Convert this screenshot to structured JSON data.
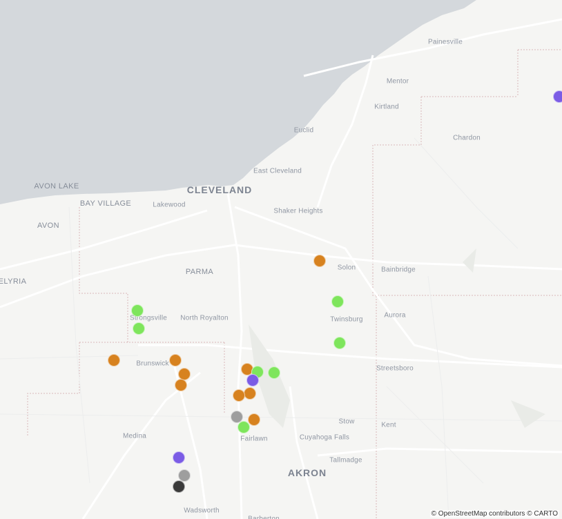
{
  "map": {
    "attribution": "© OpenStreetMap contributors © CARTO",
    "colors": {
      "water": "#d4d8dc",
      "land": "#f5f5f3",
      "road": "#ffffff",
      "boundary": "#d9b8b8"
    },
    "places": [
      {
        "name": "Painesville",
        "size": "small"
      },
      {
        "name": "Mentor",
        "size": "small"
      },
      {
        "name": "Kirtland",
        "size": "small"
      },
      {
        "name": "Euclid",
        "size": "small"
      },
      {
        "name": "Chardon",
        "size": "small"
      },
      {
        "name": "East Cleveland",
        "size": "small"
      },
      {
        "name": "AVON LAKE",
        "size": "mid"
      },
      {
        "name": "CLEVELAND",
        "size": "big"
      },
      {
        "name": "BAY VILLAGE",
        "size": "mid"
      },
      {
        "name": "Lakewood",
        "size": "small"
      },
      {
        "name": "Shaker Heights",
        "size": "small"
      },
      {
        "name": "AVON",
        "size": "mid"
      },
      {
        "name": "PARMA",
        "size": "mid"
      },
      {
        "name": "Solon",
        "size": "small"
      },
      {
        "name": "Bainbridge",
        "size": "small"
      },
      {
        "name": "ELYRIA",
        "size": "mid"
      },
      {
        "name": "Aurora",
        "size": "small"
      },
      {
        "name": "Strongsville",
        "size": "small"
      },
      {
        "name": "North Royalton",
        "size": "small"
      },
      {
        "name": "Twinsburg",
        "size": "small"
      },
      {
        "name": "Brunswick",
        "size": "small"
      },
      {
        "name": "Streetsboro",
        "size": "small"
      },
      {
        "name": "Stow",
        "size": "small"
      },
      {
        "name": "Kent",
        "size": "small"
      },
      {
        "name": "Medina",
        "size": "small"
      },
      {
        "name": "Fairlawn",
        "size": "small"
      },
      {
        "name": "Cuyahoga Falls",
        "size": "small"
      },
      {
        "name": "Tallmadge",
        "size": "small"
      },
      {
        "name": "AKRON",
        "size": "big"
      },
      {
        "name": "Wadsworth",
        "size": "small"
      },
      {
        "name": "Barberton",
        "size": "small"
      }
    ],
    "marker_colors": {
      "green": "#7ee55c",
      "orange": "#d7821f",
      "purple": "#7b5ce5",
      "gray": "#9e9e9e",
      "dark": "#3a3a3a"
    },
    "markers": [
      {
        "lat": 41.744,
        "lon": -81.063,
        "color": "purple"
      },
      {
        "lat": 41.545,
        "lon": -81.496,
        "color": "orange"
      },
      {
        "lat": 41.496,
        "lon": -81.463,
        "color": "green"
      },
      {
        "lat": 41.485,
        "lon": -81.825,
        "color": "green"
      },
      {
        "lat": 41.463,
        "lon": -81.823,
        "color": "green"
      },
      {
        "lat": 41.446,
        "lon": -81.459,
        "color": "green"
      },
      {
        "lat": 41.425,
        "lon": -81.868,
        "color": "orange"
      },
      {
        "lat": 41.425,
        "lon": -81.757,
        "color": "orange"
      },
      {
        "lat": 41.408,
        "lon": -81.74,
        "color": "orange"
      },
      {
        "lat": 41.395,
        "lon": -81.747,
        "color": "orange"
      },
      {
        "lat": 41.414,
        "lon": -81.627,
        "color": "orange"
      },
      {
        "lat": 41.411,
        "lon": -81.608,
        "color": "green"
      },
      {
        "lat": 41.401,
        "lon": -81.617,
        "color": "purple"
      },
      {
        "lat": 41.41,
        "lon": -81.578,
        "color": "green"
      },
      {
        "lat": 41.385,
        "lon": -81.622,
        "color": "orange"
      },
      {
        "lat": 41.382,
        "lon": -81.642,
        "color": "orange"
      },
      {
        "lat": 41.356,
        "lon": -81.645,
        "color": "gray"
      },
      {
        "lat": 41.353,
        "lon": -81.614,
        "color": "orange"
      },
      {
        "lat": 41.344,
        "lon": -81.633,
        "color": "green"
      },
      {
        "lat": 41.307,
        "lon": -81.75,
        "color": "purple"
      },
      {
        "lat": 41.285,
        "lon": -81.74,
        "color": "gray"
      },
      {
        "lat": 41.272,
        "lon": -81.75,
        "color": "dark"
      }
    ]
  }
}
